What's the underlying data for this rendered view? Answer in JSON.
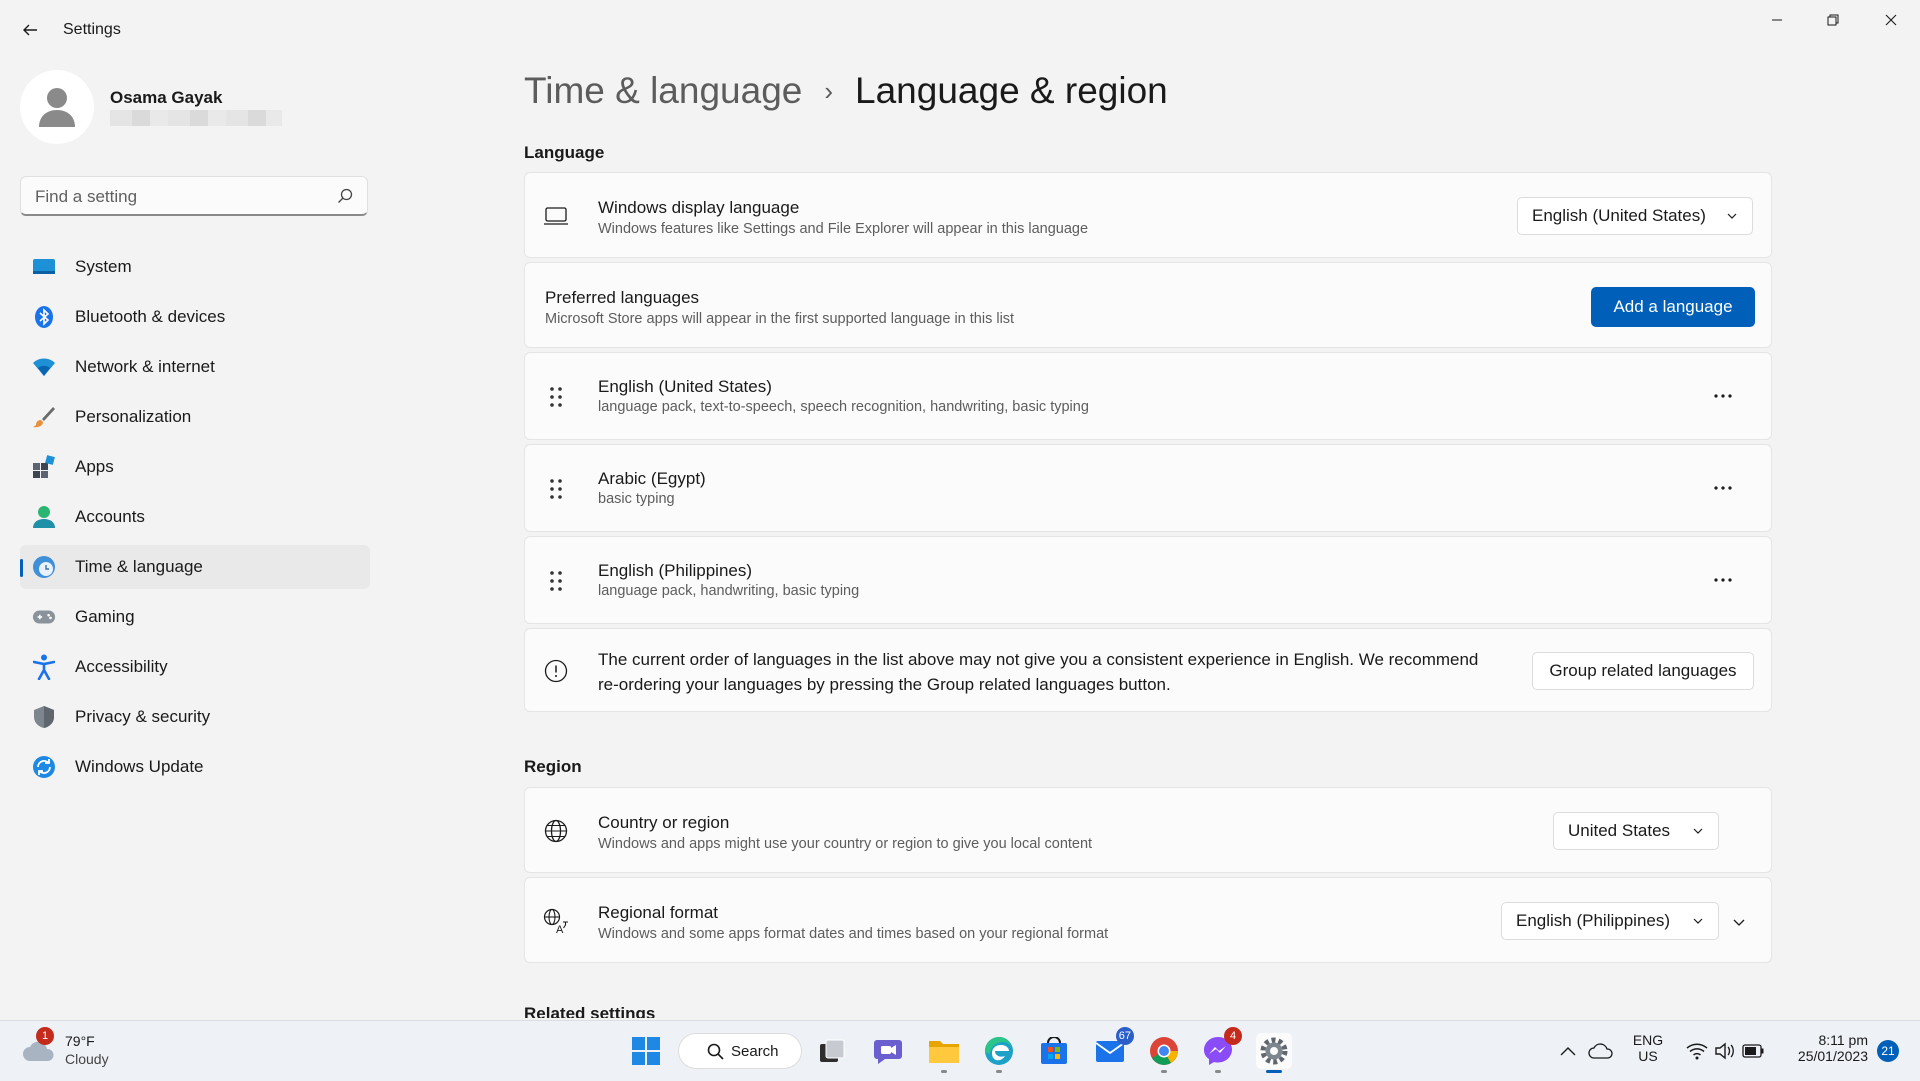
{
  "window": {
    "title": "Settings"
  },
  "user": {
    "name": "Osama Gayak"
  },
  "search": {
    "placeholder": "Find a setting"
  },
  "sidebar": {
    "items": [
      {
        "label": "System",
        "icon": "system-icon"
      },
      {
        "label": "Bluetooth & devices",
        "icon": "bluetooth-icon"
      },
      {
        "label": "Network & internet",
        "icon": "wifi-icon"
      },
      {
        "label": "Personalization",
        "icon": "brush-icon"
      },
      {
        "label": "Apps",
        "icon": "apps-icon"
      },
      {
        "label": "Accounts",
        "icon": "account-icon"
      },
      {
        "label": "Time & language",
        "icon": "time-language-icon",
        "active": true
      },
      {
        "label": "Gaming",
        "icon": "gamepad-icon"
      },
      {
        "label": "Accessibility",
        "icon": "accessibility-icon"
      },
      {
        "label": "Privacy & security",
        "icon": "shield-icon"
      },
      {
        "label": "Windows Update",
        "icon": "update-icon"
      }
    ]
  },
  "breadcrumb": {
    "parent": "Time & language",
    "separator": "›",
    "current": "Language & region"
  },
  "language_section": {
    "title": "Language",
    "display_language": {
      "title": "Windows display language",
      "subtitle": "Windows features like Settings and File Explorer will appear in this language",
      "value": "English (United States)"
    },
    "preferred": {
      "title": "Preferred languages",
      "subtitle": "Microsoft Store apps will appear in the first supported language in this list",
      "button": "Add a language"
    },
    "languages": [
      {
        "name": "English (United States)",
        "features": "language pack, text-to-speech, speech recognition, handwriting, basic typing"
      },
      {
        "name": "Arabic (Egypt)",
        "features": "basic typing"
      },
      {
        "name": "English (Philippines)",
        "features": "language pack, handwriting, basic typing"
      }
    ],
    "warning": {
      "text": "The current order of languages in the list above may not give you a consistent experience in English. We recommend re-ordering your languages by pressing the Group related languages button.",
      "button": "Group related languages"
    }
  },
  "region_section": {
    "title": "Region",
    "country": {
      "title": "Country or region",
      "subtitle": "Windows and apps might use your country or region to give you local content",
      "value": "United States"
    },
    "format": {
      "title": "Regional format",
      "subtitle": "Windows and some apps format dates and times based on your regional format",
      "value": "English (Philippines)"
    }
  },
  "related_settings": {
    "title": "Related settings"
  },
  "taskbar": {
    "weather": {
      "temp": "79°F",
      "desc": "Cloudy",
      "badge": "1"
    },
    "search_label": "Search",
    "mail_badge": "67",
    "messenger_badge": "4",
    "lang_line1": "ENG",
    "lang_line2": "US",
    "time": "8:11 pm",
    "date": "25/01/2023",
    "notification_count": "21"
  },
  "colors": {
    "accent": "#005fb8",
    "background": "#f3f3f3",
    "card": "#fbfbfb"
  }
}
